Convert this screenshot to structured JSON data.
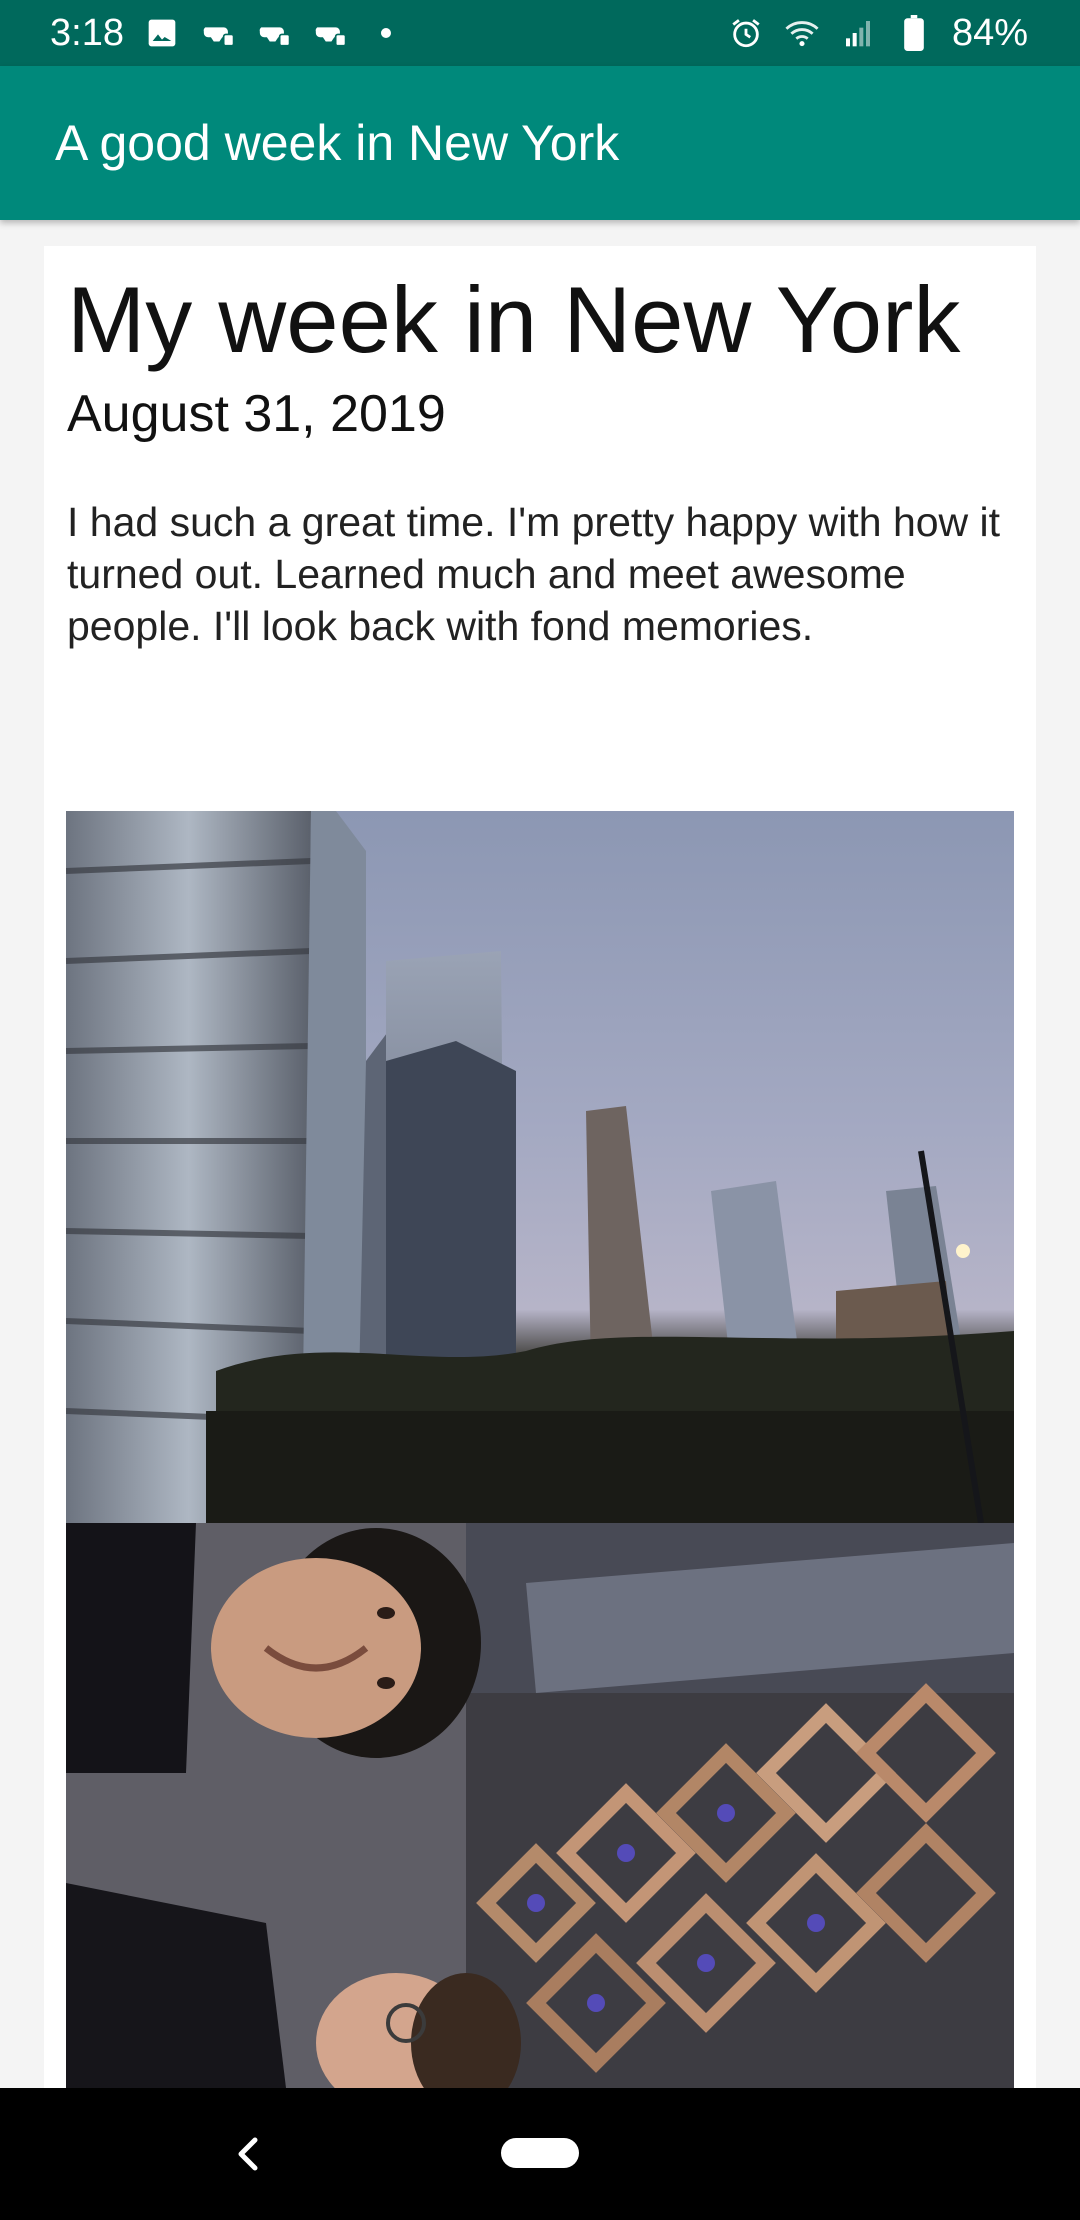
{
  "status_bar": {
    "time": "3:18",
    "battery_percent": "84%",
    "left_icons": [
      "image-icon",
      "gamepad-icon",
      "gamepad-icon",
      "gamepad-icon",
      "dot-icon"
    ],
    "right_icons": [
      "alarm-icon",
      "wifi-icon",
      "signal-icon",
      "battery-icon"
    ],
    "background": "#00695c"
  },
  "app_bar": {
    "title": "A good week in New York",
    "background": "#00897b"
  },
  "post": {
    "title": "My week in New York",
    "date": "August 31, 2019",
    "body": "I had such a great time. I'm pretty happy with how it turned out. Learned much and meet awesome people. I'll look back with fond memories."
  },
  "photos": [
    {
      "name": "city-skyline-photo"
    },
    {
      "name": "selfie-vessel-photo"
    }
  ],
  "nav_bar": {
    "icons": [
      "back-icon",
      "home-pill-icon"
    ]
  }
}
